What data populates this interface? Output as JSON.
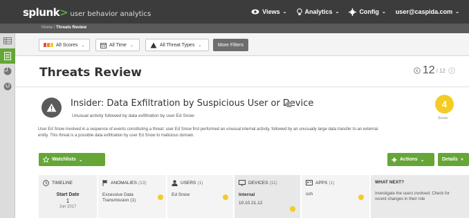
{
  "topbar": {
    "brand": "splunk",
    "brand_gt": ">",
    "brand_sub": " user behavior analytics",
    "views": "Views",
    "analytics": "Analytics",
    "config": "Config",
    "user": "user@caspida.com"
  },
  "breadcrumb": {
    "home": "Home",
    "sep": " / ",
    "current": "Threats Review"
  },
  "filters": {
    "scores": "All Scores",
    "time": "All Time",
    "types": "All Threat Types",
    "more": "More Filters"
  },
  "page": {
    "title": "Threats Review",
    "pager_current": "12",
    "pager_total": "/ 12"
  },
  "threat": {
    "title": "Insider: Data Exfiltration by Suspicious User or Device",
    "subtitle": "Unusual activity followed by data exfiltration by user Ed Snow",
    "score": "4",
    "score_label": "Score",
    "description": "User Ed Snow involved in a sequence of events constituting a threat: user Ed Snow first performed an unusual internal activity, followed by an unusually large data transfer to an external entity. This threat is a possible data exfiltration by user Ed Snow to malicious domain."
  },
  "buttons": {
    "watchlists": "Watchlists",
    "actions": "Actions",
    "details": "Details"
  },
  "cards": {
    "timeline": {
      "header": "TIMELINE",
      "start_label": "Start Date",
      "start_day": "1",
      "start_month": "Jun 2017"
    },
    "anomalies": {
      "header": "ANOMALIES",
      "count": "(13)",
      "item": "Excessive Data Transmission (1)"
    },
    "users": {
      "header": "USERS",
      "count": "(1)",
      "item": "Ed Snow"
    },
    "devices": {
      "header": "DEVICES",
      "count": "(11)",
      "item_label": "Internal",
      "item": "10.10.21.12"
    },
    "apps": {
      "header": "APPS",
      "count": "(1)",
      "item": "ssh"
    },
    "next": {
      "header": "WHAT NEXT?",
      "text": "Investigate the users involved. Check for recent changes in their role"
    }
  },
  "colors": {
    "accent": "#65a637",
    "score": "#f3cc26",
    "topbar": "#3c3c3c"
  }
}
